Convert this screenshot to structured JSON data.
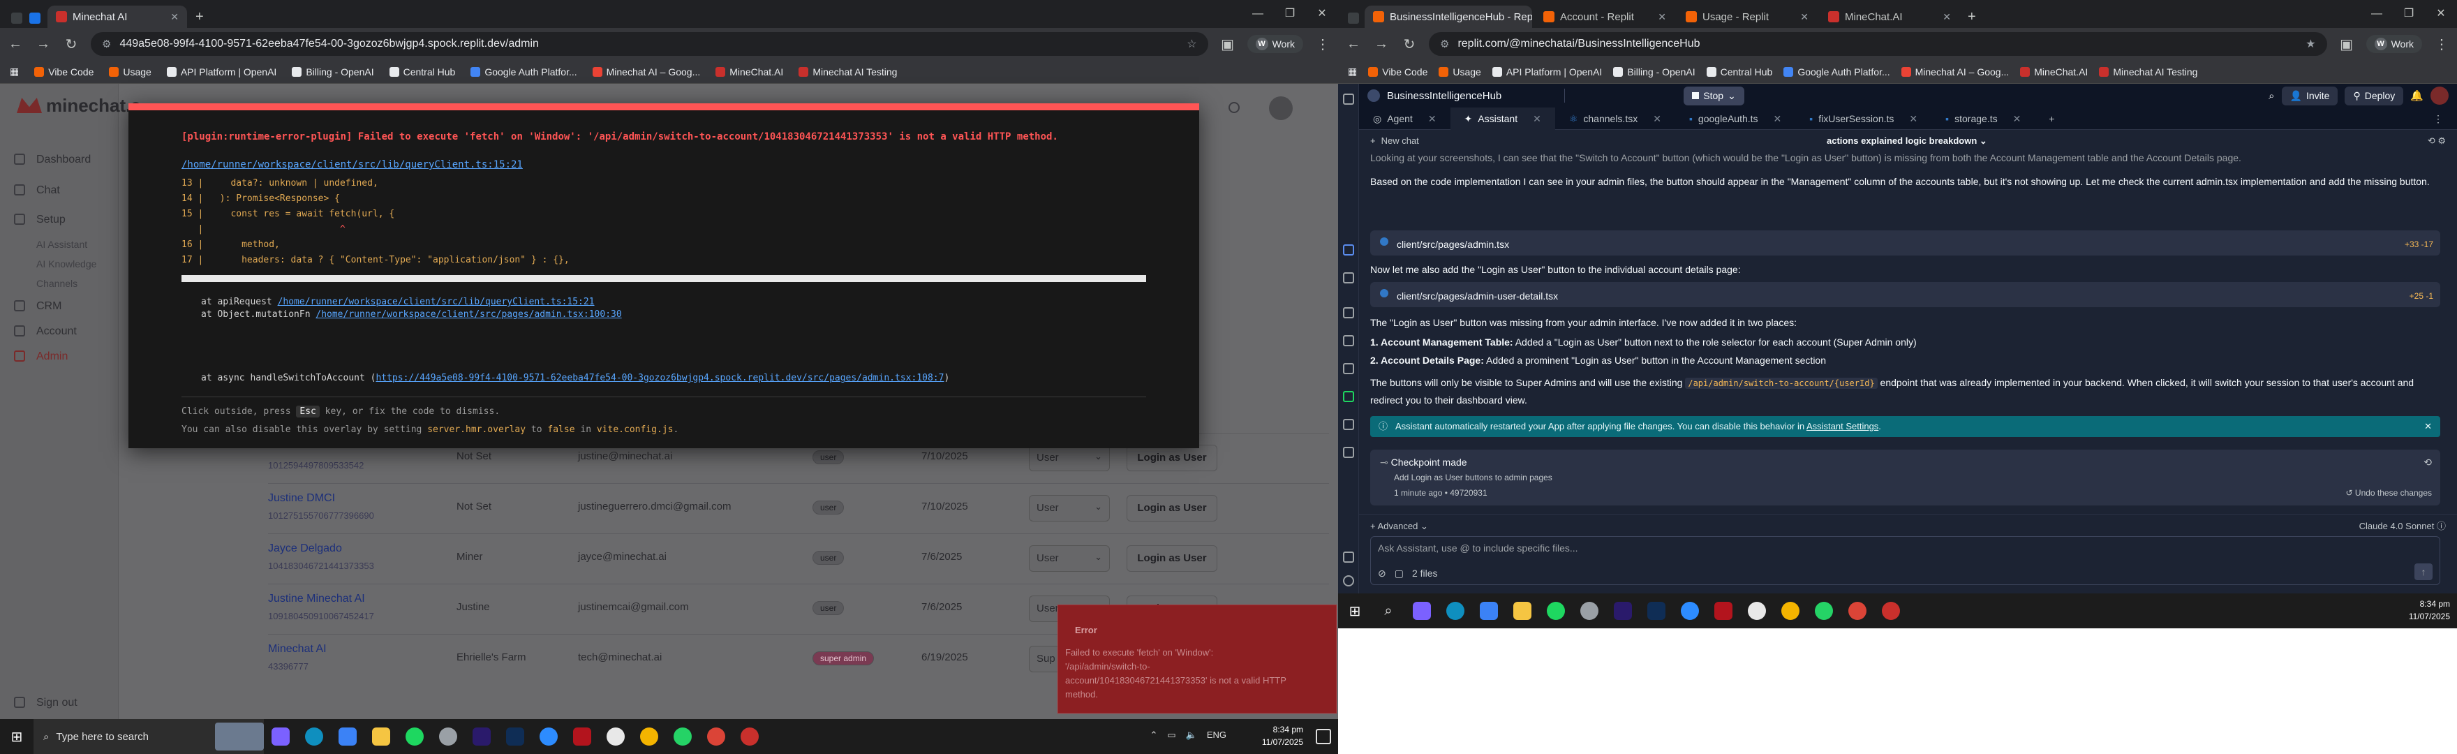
{
  "left": {
    "tabs": [
      {
        "title": "Minechat AI",
        "active": true
      }
    ],
    "url": "449a5e08-99f4-4100-9571-62eeba47fe54-00-3gozoz6bwjgp4.spock.replit.dev/admin",
    "profile": "Work",
    "bookmarks": [
      "Vibe Code",
      "Usage",
      "API Platform | OpenAI",
      "Billing - OpenAI",
      "Central Hub",
      "Google Auth Platfor...",
      "Minechat AI – Goog...",
      "MineChat.AI",
      "Minechat AI Testing"
    ],
    "app": {
      "logo": "minechat.a",
      "sidebar": [
        "Dashboard",
        "Chat",
        "Setup",
        "AI Assistant",
        "AI Knowledge",
        "Channels",
        "CRM",
        "Account",
        "Admin"
      ],
      "signout": "Sign out",
      "rows": [
        {
          "name": "",
          "id": "1012594497809533542",
          "display": "Not Set",
          "email": "justine@minechat.ai",
          "role": "user",
          "date": "7/10/2025",
          "select": "User",
          "action": "Login as User"
        },
        {
          "name": "Justine DMCI",
          "id": "101275155706777396690",
          "display": "Not Set",
          "email": "justineguerrero.dmci@gmail.com",
          "role": "user",
          "date": "7/10/2025",
          "select": "User",
          "action": "Login as User"
        },
        {
          "name": "Jayce Delgado",
          "id": "104183046721441373353",
          "display": "Miner",
          "email": "jayce@minechat.ai",
          "role": "user",
          "date": "7/6/2025",
          "select": "User",
          "action": "Login as User"
        },
        {
          "name": "Justine Minechat AI",
          "id": "109180450910067452417",
          "display": "Justine",
          "email": "justinemcai@gmail.com",
          "role": "user",
          "date": "7/6/2025",
          "select": "User",
          "action": "Login as User"
        },
        {
          "name": "Minechat AI",
          "id": "43396777",
          "display": "Ehrielle's Farm",
          "email": "tech@minechat.ai",
          "role": "super admin",
          "date": "6/19/2025",
          "select": "Sup",
          "action": ""
        }
      ]
    },
    "overlay": {
      "plugin": "[plugin:runtime-error-plugin]",
      "message": "Failed to execute 'fetch' on 'Window': '/api/admin/switch-to-account/104183046721441373353' is not a valid HTTP method.",
      "file": "/home/runner/workspace/client/src/lib/queryClient.ts:15:21",
      "code": [
        {
          "n": "13",
          "t": "    data?: unknown | undefined,"
        },
        {
          "n": "14",
          "t": "  ): Promise<Response> {"
        },
        {
          "n": "15",
          "t": "    const res = await fetch(url, {"
        },
        {
          "n": "",
          "t": "                        ^"
        },
        {
          "n": "16",
          "t": "      method,"
        },
        {
          "n": "17",
          "t": "      headers: data ? { \"Content-Type\": \"application/json\" } : {},"
        }
      ],
      "stack1_pre": "at apiRequest ",
      "stack1_link": "/home/runner/workspace/client/src/lib/queryClient.ts:15:21",
      "stack2_pre": "at Object.mutationFn ",
      "stack2_link": "/home/runner/workspace/client/src/pages/admin.tsx:100:30",
      "stack3_pre": "at async handleSwitchToAccount (",
      "stack3_link": "https://449a5e08-99f4-4100-9571-62eeba47fe54-00-3gozoz6bwjgp4.spock.replit.dev/src/pages/admin.tsx:108:7",
      "stack3_post": ")",
      "tip1_a": "Click outside, press ",
      "tip1_key": "Esc",
      "tip1_b": " key, or fix the code to dismiss.",
      "tip2_a": "You can also disable this overlay by setting ",
      "tip2_b": "server.hmr.overlay",
      "tip2_c": " to ",
      "tip2_d": "false",
      "tip2_e": " in ",
      "tip2_f": "vite.config.js",
      "tip2_g": "."
    },
    "toast": {
      "title": "Error",
      "body": "Failed to execute 'fetch' on 'Window': '/api/admin/switch-to-account/104183046721441373353' is not a valid HTTP method."
    },
    "taskbar": {
      "search": "Type here to search",
      "lang": "ENG",
      "time": "8:34 pm",
      "date": "11/07/2025"
    }
  },
  "right": {
    "tabs": [
      {
        "title": "BusinessIntelligenceHub - Replit",
        "active": true
      },
      {
        "title": "Account - Replit",
        "active": false
      },
      {
        "title": "Usage - Replit",
        "active": false
      },
      {
        "title": "MineChat.AI",
        "active": false
      }
    ],
    "url": "replit.com/@minechatai/BusinessIntelligenceHub",
    "profile": "Work",
    "bookmarks": [
      "Vibe Code",
      "Usage",
      "API Platform | OpenAI",
      "Billing - OpenAI",
      "Central Hub",
      "Google Auth Platfor...",
      "Minechat AI – Goog...",
      "MineChat.AI",
      "Minechat AI Testing"
    ],
    "project": "BusinessIntelligenceHub",
    "stop": "Stop",
    "invite": "Invite",
    "deploy": "Deploy",
    "tabs2": [
      "Agent",
      "Assistant",
      "channels.tsx",
      "googleAuth.ts",
      "fixUserSession.ts",
      "storage.ts"
    ],
    "new_chat": "New chat",
    "chat_title": "actions explained logic breakdown",
    "para1": "Looking at your screenshots, I can see that the \"Switch to Account\" button (which would be the \"Login as User\" button) is missing from both the Account Management table and the Account Details page.",
    "para2": "Based on the code implementation I can see in your admin files, the button should appear in the \"Management\" column of the accounts table, but it's not showing up. Let me check the current admin.tsx implementation and add the missing button.",
    "file1": "client/src/pages/admin.tsx",
    "file1_diff": "+33 -17",
    "para3": "Now let me also add the \"Login as User\" button to the individual account details page:",
    "file2": "client/src/pages/admin-user-detail.tsx",
    "file2_diff": "+25 -1",
    "para4": "The \"Login as User\" button was missing from your admin interface. I've now added it in two places:",
    "li1_b": "1. Account Management Table:",
    "li1": " Added a \"Login as User\" button next to the role selector for each account (Super Admin only)",
    "li2_b": "2. Account Details Page:",
    "li2": " Added a prominent \"Login as User\" button in the Account Management section",
    "para5_a": "The buttons will only be visible to Super Admins and will use the existing ",
    "para5_code": "/api/admin/switch-to-account/{userId}",
    "para5_b": " endpoint that was already implemented in your backend. When clicked, it will switch your session to that user's account and redirect you to their dashboard view.",
    "notice_a": "Assistant automatically restarted your App after applying file changes. You can disable this behavior in ",
    "notice_link": "Assistant Settings",
    "notice_b": ".",
    "checkpoint": "Checkpoint made",
    "checkpoint_sub": "Add Login as User buttons to admin pages",
    "checkpoint_meta": "1 minute ago  •  49720931",
    "undo": "Undo these changes",
    "advanced": "Advanced",
    "model": "Claude 4.0 Sonnet",
    "input_placeholder": "Ask Assistant, use @ to include specific files...",
    "files": "2 files",
    "taskbar": {
      "time": "8:34 pm",
      "date": "11/07/2025"
    }
  },
  "colors": {
    "error_red": "#ff5555",
    "replit_bg": "#1c2333",
    "replit_orange": "#f26207",
    "notice_teal": "#0a6b78"
  }
}
